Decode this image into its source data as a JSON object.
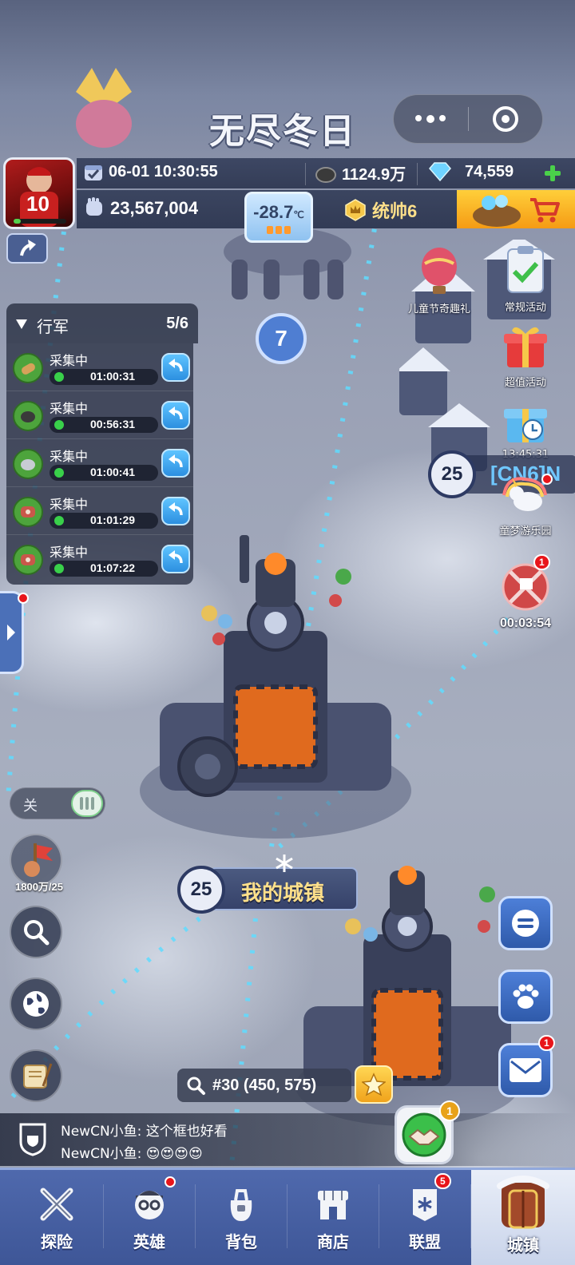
{
  "title": "无尽冬日",
  "capsule": {
    "more": "more-dots-icon",
    "close": "target-circle-icon"
  },
  "profile": {
    "jersey_number": "10",
    "health_fraction": 0.14
  },
  "stats": {
    "datetime": "06-01 10:30:55",
    "wood": "1124.9万",
    "gems": "74,559",
    "power": "23,567,004",
    "temperature": "-28.7",
    "temperature_unit": "℃",
    "commander_rank": "统帅6"
  },
  "march": {
    "title": "行军",
    "count": "5/6",
    "items": [
      {
        "resource": "wood-log-icon",
        "status": "采集中",
        "time": "01:00:31"
      },
      {
        "resource": "coal-ore-icon",
        "status": "采集中",
        "time": "00:56:31"
      },
      {
        "resource": "iron-ore-icon",
        "status": "采集中",
        "time": "01:00:41"
      },
      {
        "resource": "meat-icon",
        "status": "采集中",
        "time": "01:01:29"
      },
      {
        "resource": "meat-icon",
        "status": "采集中",
        "time": "01:07:22"
      }
    ]
  },
  "map": {
    "beast_level": "7",
    "town_level": "25",
    "town_name": "我的城镇",
    "neighbor_level": "25",
    "neighbor_tag": "[CN6]N",
    "coords": "#30 (450, 575)"
  },
  "toggle": {
    "label": "关"
  },
  "rally": {
    "label": "1800万/25"
  },
  "events": {
    "children": "儿童节奇趣礼",
    "regular": "常规活动",
    "value": "超值活动",
    "value_timer": "13:45:31",
    "park": "童梦游乐园",
    "battle_timer": "00:03:54",
    "battle_badge": "1"
  },
  "side_buttons": {
    "mail_badge": "1"
  },
  "chat": {
    "lines": [
      "NewCN小鱼: 这个框也好看",
      "NewCN小鱼: 😍😍😍😍"
    ],
    "help_badge": "1"
  },
  "nav": {
    "items": [
      {
        "label": "探险"
      },
      {
        "label": "英雄"
      },
      {
        "label": "背包"
      },
      {
        "label": "商店"
      },
      {
        "label": "联盟",
        "badge": "5"
      },
      {
        "label": "城镇"
      }
    ]
  },
  "colors": {
    "accent": "#4f69ad",
    "gold": "#ffcf3a",
    "alert": "#e8151a"
  }
}
